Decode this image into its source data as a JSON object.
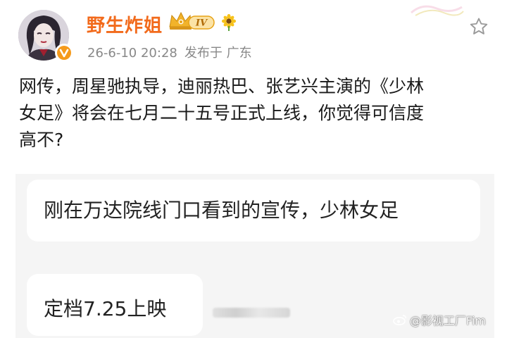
{
  "post": {
    "author": {
      "name": "野生炸姐",
      "level_badge": "IV",
      "verified_icon": "verified-v-icon",
      "emoji": "sunflower-icon"
    },
    "timestamp": "26-6-10 20:28",
    "location": "发布于 广东",
    "follow_icon": "star-outline-icon",
    "text_lines": [
      "网传，周星驰执导，迪丽热巴、张艺兴主演的《少林",
      "女足》将会在七月二十五号正式上线，你觉得可信度",
      "高不?"
    ]
  },
  "embedded_image": {
    "bubbles": [
      "刚在万达院线门口看到的宣传，少林女足",
      "定档7.25上映"
    ]
  },
  "watermark": {
    "text": "@影视工厂Fim",
    "icon": "weibo-logo-icon"
  },
  "colors": {
    "username": "#f26a1b",
    "meta": "#888888",
    "text": "#1a1a1a",
    "bubble_bg": "#ffffff",
    "shot_bg": "#f5f5f5",
    "badge_gold": "#e7a317"
  }
}
